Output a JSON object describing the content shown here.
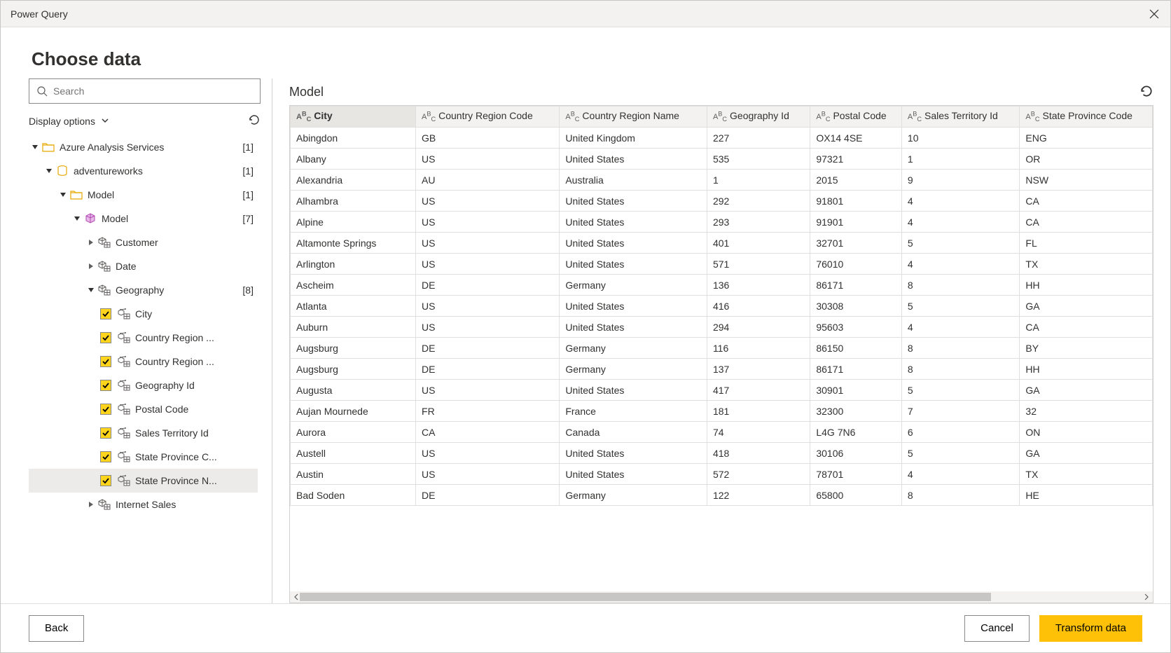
{
  "window": {
    "title": "Power Query"
  },
  "header": {
    "title": "Choose data"
  },
  "search": {
    "placeholder": "Search"
  },
  "display_options": {
    "label": "Display options"
  },
  "tree": {
    "root": {
      "label": "Azure Analysis Services",
      "count": "[1]",
      "children": [
        {
          "label": "adventureworks",
          "count": "[1]",
          "icon": "database",
          "children": [
            {
              "label": "Model",
              "count": "[1]",
              "icon": "folder",
              "children": [
                {
                  "label": "Model",
                  "count": "[7]",
                  "icon": "cube",
                  "children": [
                    {
                      "label": "Customer",
                      "icon": "table",
                      "leaf_expander": "right"
                    },
                    {
                      "label": "Date",
                      "icon": "table",
                      "leaf_expander": "right"
                    },
                    {
                      "label": "Geography",
                      "count": "[8]",
                      "icon": "table",
                      "children": [
                        {
                          "label": "City",
                          "checked": true
                        },
                        {
                          "label": "Country Region ...",
                          "checked": true
                        },
                        {
                          "label": "Country Region ...",
                          "checked": true
                        },
                        {
                          "label": "Geography Id",
                          "checked": true
                        },
                        {
                          "label": "Postal Code",
                          "checked": true
                        },
                        {
                          "label": "Sales Territory Id",
                          "checked": true
                        },
                        {
                          "label": "State Province C...",
                          "checked": true
                        },
                        {
                          "label": "State Province N...",
                          "checked": true,
                          "selected": true
                        }
                      ]
                    },
                    {
                      "label": "Internet Sales",
                      "icon": "table",
                      "leaf_expander": "right"
                    }
                  ]
                }
              ]
            }
          ]
        }
      ]
    }
  },
  "table": {
    "title": "Model",
    "columns": [
      "City",
      "Country Region Code",
      "Country Region Name",
      "Geography Id",
      "Postal Code",
      "Sales Territory Id",
      "State Province Code"
    ],
    "rows": [
      [
        "Abingdon",
        "GB",
        "United Kingdom",
        "227",
        "OX14 4SE",
        "10",
        "ENG"
      ],
      [
        "Albany",
        "US",
        "United States",
        "535",
        "97321",
        "1",
        "OR"
      ],
      [
        "Alexandria",
        "AU",
        "Australia",
        "1",
        "2015",
        "9",
        "NSW"
      ],
      [
        "Alhambra",
        "US",
        "United States",
        "292",
        "91801",
        "4",
        "CA"
      ],
      [
        "Alpine",
        "US",
        "United States",
        "293",
        "91901",
        "4",
        "CA"
      ],
      [
        "Altamonte Springs",
        "US",
        "United States",
        "401",
        "32701",
        "5",
        "FL"
      ],
      [
        "Arlington",
        "US",
        "United States",
        "571",
        "76010",
        "4",
        "TX"
      ],
      [
        "Ascheim",
        "DE",
        "Germany",
        "136",
        "86171",
        "8",
        "HH"
      ],
      [
        "Atlanta",
        "US",
        "United States",
        "416",
        "30308",
        "5",
        "GA"
      ],
      [
        "Auburn",
        "US",
        "United States",
        "294",
        "95603",
        "4",
        "CA"
      ],
      [
        "Augsburg",
        "DE",
        "Germany",
        "116",
        "86150",
        "8",
        "BY"
      ],
      [
        "Augsburg",
        "DE",
        "Germany",
        "137",
        "86171",
        "8",
        "HH"
      ],
      [
        "Augusta",
        "US",
        "United States",
        "417",
        "30901",
        "5",
        "GA"
      ],
      [
        "Aujan Mournede",
        "FR",
        "France",
        "181",
        "32300",
        "7",
        "32"
      ],
      [
        "Aurora",
        "CA",
        "Canada",
        "74",
        "L4G 7N6",
        "6",
        "ON"
      ],
      [
        "Austell",
        "US",
        "United States",
        "418",
        "30106",
        "5",
        "GA"
      ],
      [
        "Austin",
        "US",
        "United States",
        "572",
        "78701",
        "4",
        "TX"
      ],
      [
        "Bad Soden",
        "DE",
        "Germany",
        "122",
        "65800",
        "8",
        "HE"
      ]
    ]
  },
  "footer": {
    "back": "Back",
    "cancel": "Cancel",
    "transform": "Transform data"
  }
}
